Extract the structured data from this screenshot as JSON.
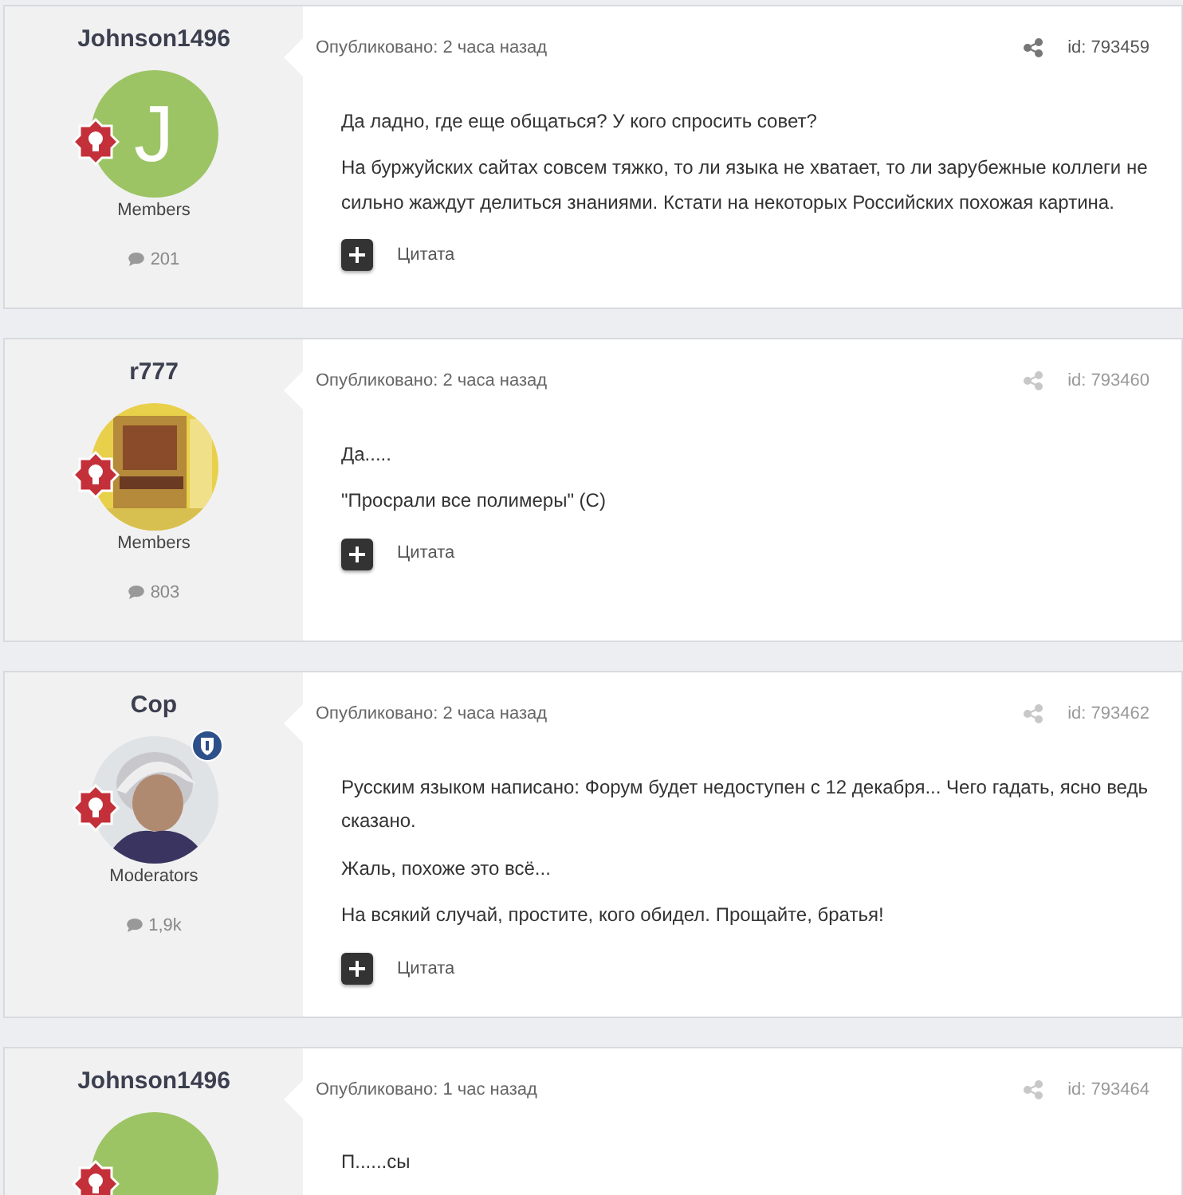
{
  "posts": [
    {
      "author": "Johnson1496",
      "avatar": {
        "kind": "letter",
        "letter": "J"
      },
      "moderator": false,
      "group": "Members",
      "post_count": "201",
      "posted": "Опубликовано: 2 часа назад",
      "id": "id: 793459",
      "faded": false,
      "paragraphs": [
        "Да ладно, где еще общаться? У кого спросить совет?",
        "На буржуйских сайтах совсем тяжко, то ли языка не хватает, то ли зарубежные коллеги не сильно жаждут делиться знаниями. Кстати на некоторых Российских похожая картина."
      ],
      "quote": "Цитата"
    },
    {
      "author": "r777",
      "avatar": {
        "kind": "picture"
      },
      "moderator": false,
      "group": "Members",
      "post_count": "803",
      "posted": "Опубликовано: 2 часа назад",
      "id": "id: 793460",
      "faded": true,
      "paragraphs": [
        "Да.....",
        "\"Просрали все полимеры\" (С)"
      ],
      "quote": "Цитата"
    },
    {
      "author": "Cop",
      "avatar": {
        "kind": "picture"
      },
      "moderator": true,
      "group": "Moderators",
      "post_count": "1,9k",
      "posted": "Опубликовано: 2 часа назад",
      "id": "id: 793462",
      "faded": true,
      "paragraphs": [
        "Русским языком написано: Форум будет недоступен с 12 декабря... Чего гадать, ясно ведь сказано.",
        "Жаль, похоже это всё...",
        "На всякий случай, простите, кого обидел. Прощайте, братья!"
      ],
      "quote": "Цитата"
    },
    {
      "author": "Johnson1496",
      "avatar": {
        "kind": "letter"
      },
      "moderator": false,
      "posted": "Опубликовано: 1 час назад",
      "id": "id: 793464",
      "faded": true,
      "paragraphs": [
        "П......сы"
      ]
    }
  ]
}
